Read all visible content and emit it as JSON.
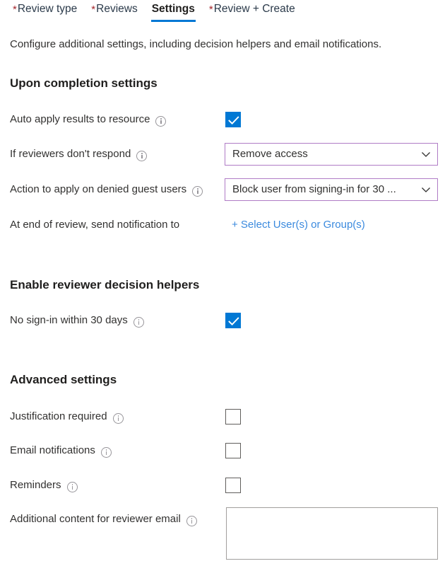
{
  "tabs": [
    {
      "label": "Review type",
      "required": true,
      "active": false
    },
    {
      "label": "Reviews",
      "required": true,
      "active": false
    },
    {
      "label": "Settings",
      "required": false,
      "active": true
    },
    {
      "label": "Review + Create",
      "required": true,
      "active": false
    }
  ],
  "required_marker": "*",
  "description": "Configure additional settings, including decision helpers and email notifications.",
  "sections": {
    "upon_completion": {
      "heading": "Upon completion settings",
      "rows": {
        "auto_apply": {
          "label": "Auto apply results to resource",
          "checked": true
        },
        "no_respond": {
          "label": "If reviewers don't respond",
          "value": "Remove access"
        },
        "denied_guest": {
          "label": "Action to apply on denied guest users",
          "value": "Block user from signing-in for 30 ..."
        },
        "notification": {
          "label": "At end of review, send notification to",
          "link_label": "+ Select User(s) or Group(s)"
        }
      }
    },
    "decision_helpers": {
      "heading": "Enable reviewer decision helpers",
      "rows": {
        "no_signin": {
          "label": "No sign-in within 30 days",
          "checked": true
        }
      }
    },
    "advanced": {
      "heading": "Advanced settings",
      "rows": {
        "justification": {
          "label": "Justification required",
          "checked": false
        },
        "email_notifications": {
          "label": "Email notifications",
          "checked": false
        },
        "reminders": {
          "label": "Reminders",
          "checked": false
        },
        "additional_content": {
          "label": "Additional content for reviewer email",
          "value": "",
          "placeholder": ""
        }
      }
    }
  },
  "colors": {
    "accent_blue": "#0078d4",
    "link_blue": "#3b8ade",
    "required_red": "#a4262c",
    "dropdown_border_purple": "#b07cc6",
    "text_primary": "#323130"
  }
}
